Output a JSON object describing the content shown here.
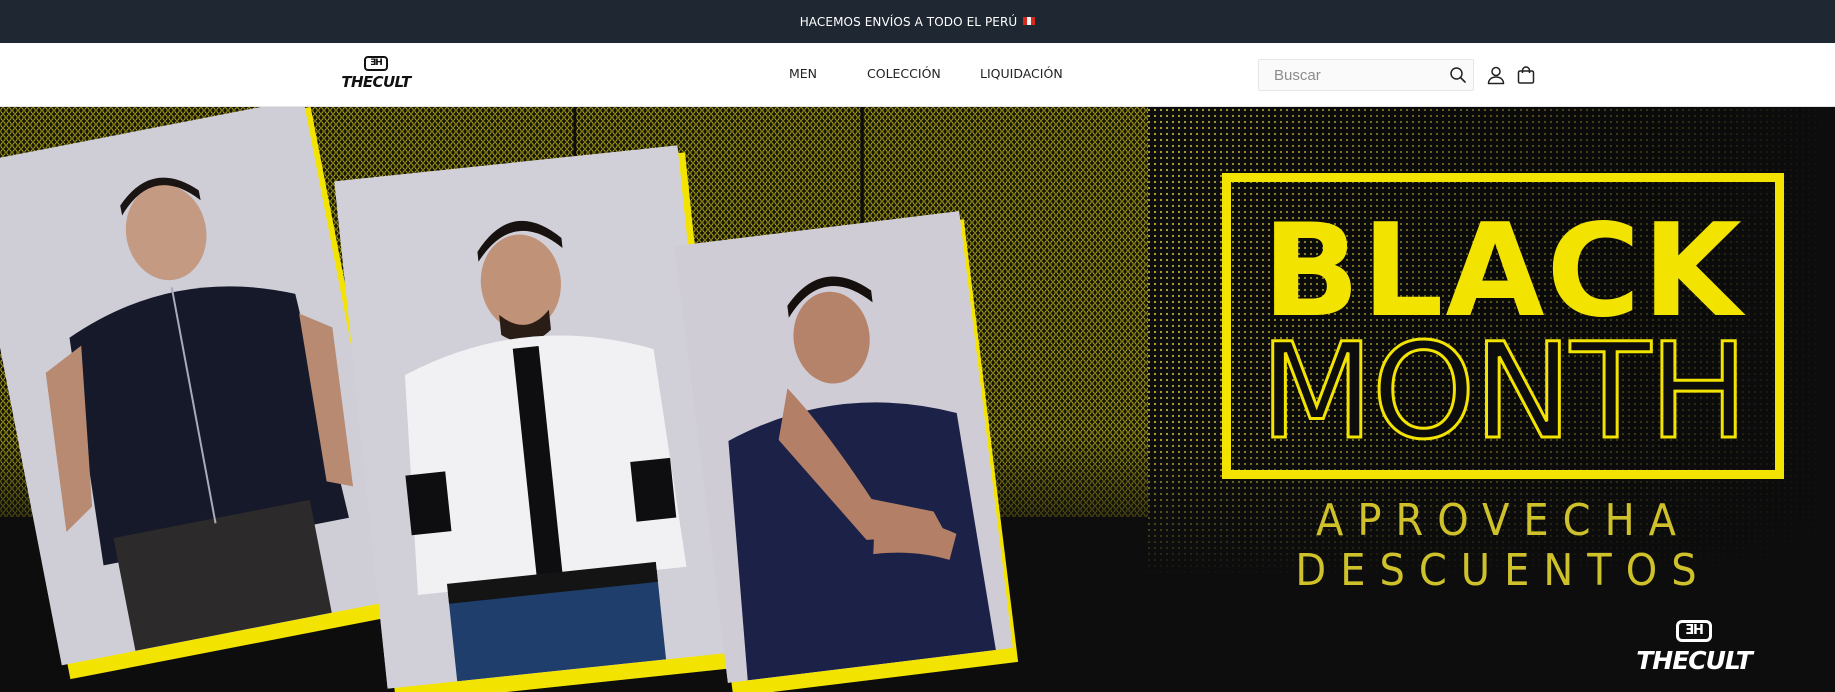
{
  "announcement": {
    "text": "HACEMOS ENVÍOS A TODO EL PERÚ",
    "flag_icon": "peru-flag-icon"
  },
  "header": {
    "logo": {
      "monogram": "ƎH",
      "wordmark": "THECULT"
    },
    "nav": [
      {
        "label": "MEN"
      },
      {
        "label": "COLECCIÓN"
      },
      {
        "label": "LIQUIDACIÓN"
      }
    ],
    "search": {
      "placeholder": "Buscar",
      "value": "",
      "icon": "search-icon"
    },
    "icons": {
      "account": "user-icon",
      "cart": "shopping-bag-icon"
    }
  },
  "hero": {
    "promo_line_1": "BLACK",
    "promo_line_2": "MONTH",
    "promo_subtitle": "APROVECHA DESCUENTOS",
    "logo": {
      "monogram": "ƎH",
      "wordmark": "THECULT"
    },
    "photos": [
      {
        "subject": "model in dark patterned short-sleeve shirt"
      },
      {
        "subject": "model in white polka-dot shirt with black placket"
      },
      {
        "subject": "model in navy short-sleeve shirt"
      }
    ]
  },
  "colors": {
    "announcement_bg": "#1f2733",
    "accent_yellow": "#f2e400",
    "hero_bg": "#0d0d0d"
  }
}
